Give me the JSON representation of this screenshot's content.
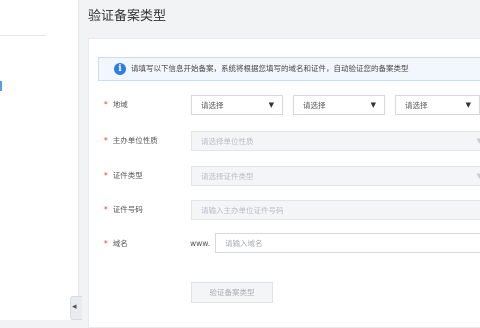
{
  "page_title": "验证备案类型",
  "collapse_icon": "◂",
  "info": {
    "icon": "i",
    "text": "请填写以下信息开始备案，系统将根据您填写的域名和证件，自动验证您的备案类型"
  },
  "form": {
    "required_mark": "*",
    "region": {
      "label": "地域",
      "selects": [
        "请选择",
        "请选择",
        "请选择"
      ],
      "caret": "▼"
    },
    "org_type": {
      "label": "主办单位性质",
      "placeholder": "请选择单位性质",
      "caret": "▼"
    },
    "cert_type": {
      "label": "证件类型",
      "placeholder": "请选择证件类型",
      "caret": "▼"
    },
    "cert_number": {
      "label": "证件号码",
      "placeholder": "请输入主办单位证件号码"
    },
    "domain": {
      "label": "域名",
      "prefix": "www.",
      "placeholder": "请输入域名"
    }
  },
  "submit_label": "验证备案类型"
}
